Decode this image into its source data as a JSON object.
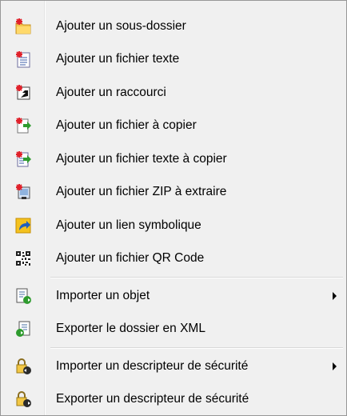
{
  "menu": {
    "items": [
      {
        "label": "Ajouter un sous-dossier",
        "icon": "new-folder-icon"
      },
      {
        "label": "Ajouter un fichier texte",
        "icon": "new-text-file-icon"
      },
      {
        "label": "Ajouter un raccourci",
        "icon": "new-shortcut-icon"
      },
      {
        "label": "Ajouter un fichier à copier",
        "icon": "copy-file-icon"
      },
      {
        "label": "Ajouter un fichier texte à copier",
        "icon": "copy-text-file-icon"
      },
      {
        "label": "Ajouter un fichier ZIP à extraire",
        "icon": "zip-file-icon"
      },
      {
        "label": "Ajouter un lien symbolique",
        "icon": "symlink-icon"
      },
      {
        "label": "Ajouter un fichier QR Code",
        "icon": "qr-code-icon"
      },
      {
        "label": "Importer un objet",
        "icon": "import-object-icon",
        "submenu": true
      },
      {
        "label": "Exporter le dossier en XML",
        "icon": "export-xml-icon"
      },
      {
        "label": "Importer un descripteur de sécurité",
        "icon": "import-security-icon",
        "submenu": true
      },
      {
        "label": "Exporter un descripteur de sécurité",
        "icon": "export-security-icon"
      }
    ]
  }
}
